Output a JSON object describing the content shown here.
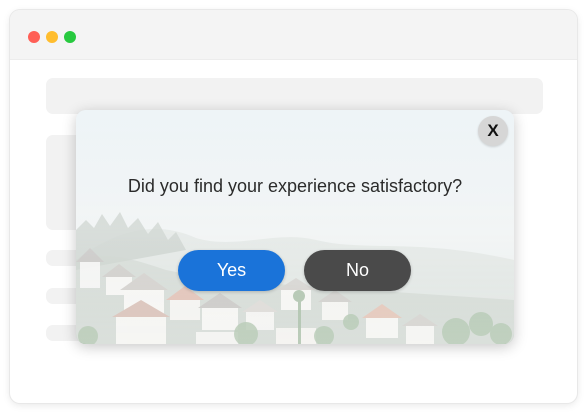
{
  "window": {
    "controls": [
      "close",
      "minimize",
      "maximize"
    ]
  },
  "modal": {
    "close_label": "X",
    "question": "Did you find your experience satisfactory?",
    "yes_label": "Yes",
    "no_label": "No"
  },
  "colors": {
    "yes_button": "#1a73d9",
    "no_button": "#4a4a4a",
    "close_button": "#d6d6d6",
    "traffic_red": "#ff5f56",
    "traffic_yellow": "#ffbd2e",
    "traffic_green": "#27c93f"
  }
}
